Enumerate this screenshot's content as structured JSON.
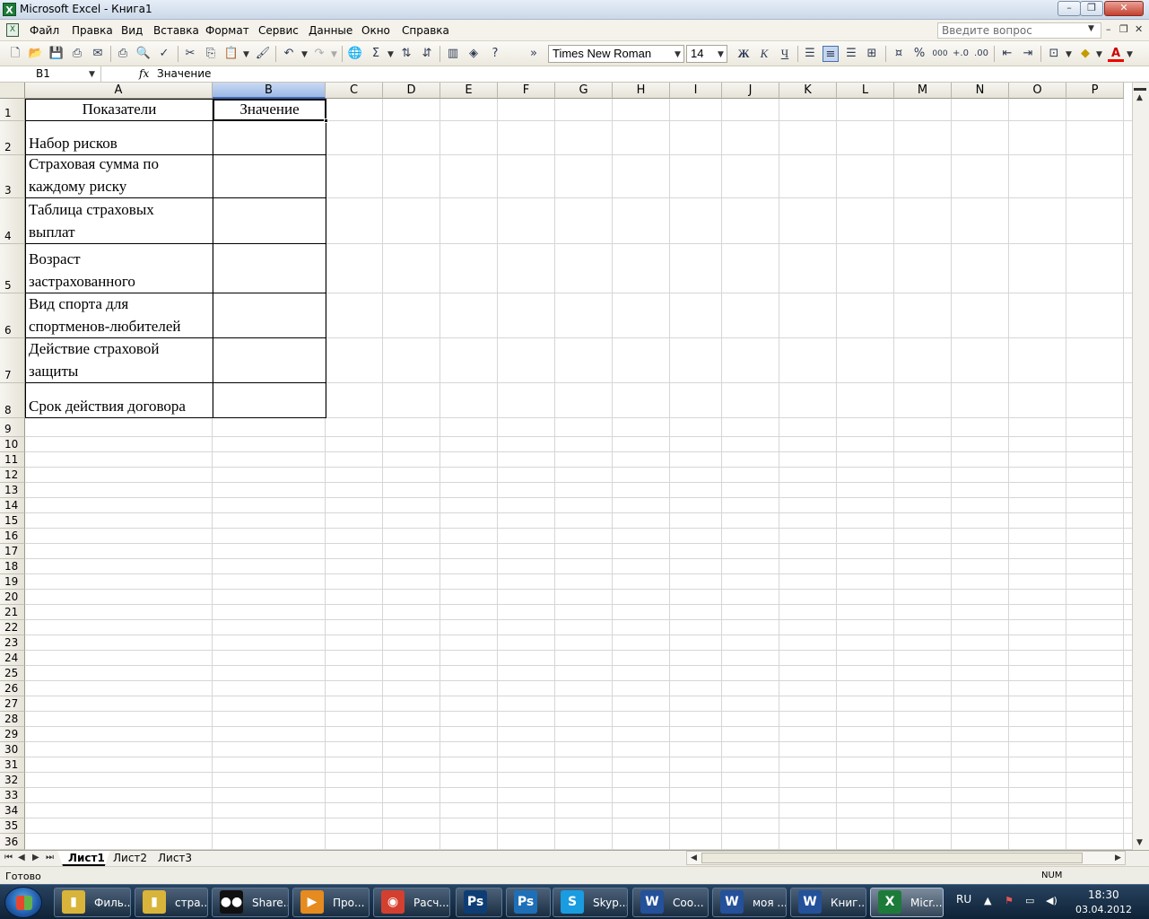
{
  "window": {
    "title": "Microsoft Excel - Книга1",
    "app_icon": "X",
    "minimize": "–",
    "restore": "❐",
    "close": "✕"
  },
  "menu": {
    "items": [
      "Файл",
      "Правка",
      "Вид",
      "Вставка",
      "Формат",
      "Сервис",
      "Данные",
      "Окно",
      "Справка"
    ],
    "help_placeholder": "Введите вопрос",
    "doc_controls": [
      "–",
      "❐",
      "✕"
    ]
  },
  "toolbar": {
    "font_name": "Times New Roman",
    "font_size": "14",
    "bold": "Ж",
    "italic": "К",
    "underline": "Ч",
    "percent": "%",
    "thousands": "000",
    "sum": "Σ",
    "more": "»"
  },
  "formula_bar": {
    "name_box": "B1",
    "fx": "fx",
    "formula": "Значение"
  },
  "columns": [
    "A",
    "B",
    "C",
    "D",
    "E",
    "F",
    "G",
    "H",
    "I",
    "J",
    "K",
    "L",
    "M",
    "N",
    "O",
    "P"
  ],
  "selected_column": "B",
  "rows": [
    "1",
    "2",
    "3",
    "4",
    "5",
    "6",
    "7",
    "8",
    "9",
    "10",
    "11",
    "12",
    "13",
    "14",
    "15",
    "16",
    "17",
    "18",
    "19",
    "20",
    "21",
    "22",
    "23",
    "24",
    "25",
    "26",
    "27",
    "28",
    "29",
    "30",
    "31",
    "32",
    "33",
    "34",
    "35",
    "36"
  ],
  "table": {
    "header": {
      "a": "Показатели",
      "b": "Значение"
    },
    "items": [
      {
        "line1": "Набор рисков",
        "line2": ""
      },
      {
        "line1": "Страховая сумма по",
        "line2": "каждому риску"
      },
      {
        "line1": "Таблица страховых",
        "line2": "выплат"
      },
      {
        "line1": "Возраст",
        "line2": "застрахованного"
      },
      {
        "line1": "Вид спорта для",
        "line2": "спортменов-любителей"
      },
      {
        "line1": "Действие страховой",
        "line2": "защиты"
      },
      {
        "line1": "Срок действия договора",
        "line2": ""
      }
    ]
  },
  "sheets": {
    "tabs": [
      "Лист1",
      "Лист2",
      "Лист3"
    ],
    "active": "Лист1"
  },
  "status": {
    "text": "Готово",
    "num": "NUM"
  },
  "taskbar": {
    "items": [
      {
        "label": "Филь...",
        "icon": "folder-icon",
        "glyph": "▮",
        "color": "#d9b43a"
      },
      {
        "label": "стра...",
        "icon": "folder-icon",
        "glyph": "▮",
        "color": "#d9b43a"
      },
      {
        "label": "Share...",
        "icon": "shareman-icon",
        "glyph": "●●",
        "color": "#111111"
      },
      {
        "label": "Про...",
        "icon": "media-player-icon",
        "glyph": "▶",
        "color": "#e58b1f"
      },
      {
        "label": "Расч...",
        "icon": "chrome-icon",
        "glyph": "◉",
        "color": "#d3402f"
      },
      {
        "label": "",
        "icon": "photoshop-icon",
        "glyph": "Ps",
        "color": "#0d3d74"
      },
      {
        "label": "",
        "icon": "photoshop-icon",
        "glyph": "Ps",
        "color": "#1e6fb8"
      },
      {
        "label": "Skyp...",
        "icon": "skype-icon",
        "glyph": "S",
        "color": "#1a9ce0"
      },
      {
        "label": "Соо...",
        "icon": "word-icon",
        "glyph": "W",
        "color": "#24519a"
      },
      {
        "label": "моя ...",
        "icon": "word-icon",
        "glyph": "W",
        "color": "#24519a"
      },
      {
        "label": "Книг...",
        "icon": "word-icon",
        "glyph": "W",
        "color": "#24519a"
      },
      {
        "label": "Micr...",
        "icon": "excel-icon",
        "glyph": "X",
        "color": "#1d7b3a"
      }
    ],
    "lang": "RU",
    "time": "18:30",
    "date": "03.04.2012"
  }
}
